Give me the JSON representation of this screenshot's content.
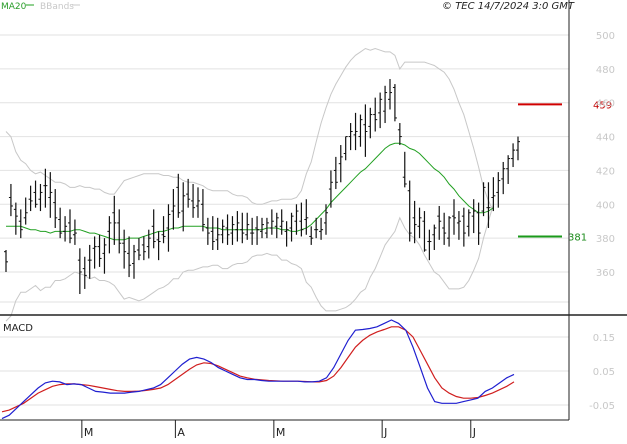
{
  "header": {
    "legend_ma": "MA20",
    "legend_bb": "BBands",
    "copyright": "© TEC 14/7/2024 3:0 GMT"
  },
  "colors": {
    "price_bars": "#111111",
    "ma20": "#22a022",
    "bbands": "#c8c8c8",
    "macd_line": "#1f1fd0",
    "signal_line": "#d01f1f",
    "level_high": "#d00000",
    "level_low": "#1a9a1a",
    "grid": "#e2e2e2",
    "panel_border": "#222222"
  },
  "chart_data": [
    {
      "type": "ohlc",
      "name": "price",
      "y_ticks": [
        360,
        380,
        400,
        420,
        440,
        460,
        480,
        500
      ],
      "y_tick_labels": [
        "360",
        "380",
        "400",
        "420",
        "440",
        "460",
        "480",
        "500"
      ],
      "ylim": [
        340,
        510
      ],
      "x_labels": [
        "M",
        "A",
        "M",
        "J",
        "J"
      ],
      "grid": true,
      "levels": [
        {
          "value": 459,
          "label": "459",
          "kind": "high"
        },
        {
          "value": 381,
          "label": "381",
          "kind": "low"
        }
      ],
      "ohlc": [
        [
          372,
          373,
          360,
          366
        ],
        [
          404,
          412,
          393,
          399
        ],
        [
          397,
          401,
          382,
          393
        ],
        [
          390,
          397,
          380,
          385
        ],
        [
          392,
          404,
          388,
          395
        ],
        [
          403,
          411,
          396,
          402
        ],
        [
          407,
          414,
          398,
          400
        ],
        [
          403,
          412,
          396,
          407
        ],
        [
          411,
          421,
          398,
          411
        ],
        [
          404,
          419,
          392,
          407
        ],
        [
          401,
          409,
          386,
          392
        ],
        [
          391,
          398,
          380,
          383
        ],
        [
          384,
          393,
          378,
          387
        ],
        [
          389,
          397,
          377,
          380
        ],
        [
          382,
          391,
          376,
          383
        ],
        [
          367,
          374,
          347,
          360
        ],
        [
          362,
          369,
          350,
          358
        ],
        [
          367,
          376,
          356,
          367
        ],
        [
          374,
          381,
          362,
          375
        ],
        [
          375,
          382,
          363,
          368
        ],
        [
          371,
          380,
          359,
          376
        ],
        [
          384,
          393,
          371,
          389
        ],
        [
          395,
          405,
          376,
          389
        ],
        [
          389,
          397,
          371,
          377
        ],
        [
          377,
          385,
          362,
          372
        ],
        [
          371,
          381,
          357,
          364
        ],
        [
          365,
          376,
          356,
          372
        ],
        [
          373,
          380,
          367,
          370
        ],
        [
          376,
          381,
          367,
          372
        ],
        [
          375,
          385,
          368,
          380
        ],
        [
          387,
          397,
          374,
          378
        ],
        [
          379,
          384,
          367,
          378
        ],
        [
          382,
          393,
          377,
          381
        ],
        [
          386,
          400,
          372,
          394
        ],
        [
          396,
          409,
          385,
          399
        ],
        [
          410,
          418,
          392,
          395
        ],
        [
          396,
          413,
          384,
          405
        ],
        [
          406,
          415,
          398,
          403
        ],
        [
          402,
          412,
          392,
          398
        ],
        [
          399,
          410,
          392,
          402
        ],
        [
          400,
          409,
          384,
          388
        ],
        [
          386,
          392,
          376,
          383
        ],
        [
          384,
          393,
          373,
          378
        ],
        [
          379,
          392,
          373,
          382
        ],
        [
          382,
          391,
          377,
          387
        ],
        [
          386,
          394,
          376,
          382
        ],
        [
          383,
          393,
          376,
          388
        ],
        [
          385,
          396,
          378,
          389
        ],
        [
          385,
          395,
          377,
          383
        ],
        [
          382,
          395,
          379,
          388
        ],
        [
          383,
          392,
          376,
          383
        ],
        [
          386,
          393,
          376,
          385
        ],
        [
          384,
          392,
          380,
          388
        ],
        [
          383,
          392,
          380,
          389
        ],
        [
          386,
          397,
          382,
          390
        ],
        [
          387,
          395,
          380,
          392
        ],
        [
          387,
          397,
          382,
          390
        ],
        [
          384,
          390,
          375,
          385
        ],
        [
          386,
          395,
          378,
          393
        ],
        [
          390,
          400,
          382,
          396
        ],
        [
          390,
          401,
          381,
          385
        ],
        [
          391,
          403,
          382,
          392
        ],
        [
          381,
          387,
          376,
          380
        ],
        [
          385,
          392,
          380,
          385
        ],
        [
          384,
          392,
          379,
          385
        ],
        [
          389,
          400,
          382,
          395
        ],
        [
          409,
          420,
          398,
          413
        ],
        [
          420,
          428,
          409,
          413
        ],
        [
          424,
          435,
          413,
          428
        ],
        [
          430,
          440,
          426,
          440
        ],
        [
          440,
          448,
          432,
          443
        ],
        [
          441,
          454,
          432,
          443
        ],
        [
          440,
          453,
          434,
          450
        ],
        [
          447,
          459,
          428,
          443
        ],
        [
          446,
          457,
          439,
          453
        ],
        [
          453,
          463,
          443,
          450
        ],
        [
          454,
          466,
          445,
          462
        ],
        [
          455,
          470,
          448,
          466
        ],
        [
          462,
          474,
          456,
          466
        ],
        [
          469,
          471,
          449,
          451
        ],
        [
          444,
          448,
          435,
          440
        ],
        [
          416,
          431,
          410,
          412
        ],
        [
          408,
          414,
          378,
          383
        ],
        [
          392,
          402,
          377,
          388
        ],
        [
          387,
          398,
          380,
          392
        ],
        [
          390,
          396,
          372,
          373
        ],
        [
          378,
          385,
          367,
          378
        ],
        [
          382,
          388,
          373,
          386
        ],
        [
          393,
          399,
          379,
          390
        ],
        [
          386,
          395,
          376,
          383
        ],
        [
          380,
          393,
          375,
          392
        ],
        [
          393,
          403,
          382,
          392
        ],
        [
          389,
          396,
          379,
          390
        ],
        [
          393,
          398,
          375,
          383
        ],
        [
          387,
          397,
          381,
          395
        ],
        [
          393,
          403,
          383,
          396
        ],
        [
          395,
          401,
          376,
          383
        ],
        [
          396,
          413,
          393,
          410
        ],
        [
          398,
          413,
          386,
          398
        ],
        [
          404,
          416,
          396,
          405
        ],
        [
          407,
          419,
          398,
          414
        ],
        [
          415,
          425,
          406,
          421
        ],
        [
          421,
          429,
          412,
          427
        ],
        [
          427,
          436,
          422,
          432
        ],
        [
          432,
          440,
          426,
          437
        ]
      ],
      "ma20": [
        387,
        387,
        387,
        387,
        386,
        385,
        385,
        384,
        384,
        383,
        384,
        384,
        384,
        384,
        385,
        385,
        384,
        383,
        383,
        382,
        381,
        380,
        379,
        379,
        379,
        380,
        380,
        380,
        381,
        382,
        383,
        384,
        384,
        385,
        386,
        386,
        387,
        387,
        387,
        387,
        387,
        386,
        386,
        386,
        385,
        385,
        385,
        385,
        385,
        385,
        385,
        385,
        385,
        386,
        386,
        386,
        385,
        385,
        384,
        384,
        385,
        386,
        388,
        391,
        394,
        397,
        401,
        404,
        407,
        410,
        413,
        416,
        419,
        421,
        424,
        427,
        430,
        433,
        435,
        436,
        436,
        435,
        433,
        432,
        430,
        427,
        424,
        421,
        419,
        416,
        412,
        409,
        405,
        402,
        399,
        397,
        395,
        395,
        396,
        398
      ],
      "bb_upper": [
        443,
        440,
        431,
        426,
        424,
        420,
        418,
        419,
        417,
        415,
        413,
        413,
        412,
        410,
        410,
        411,
        410,
        410,
        409,
        409,
        407,
        406,
        406,
        410,
        414,
        415,
        416,
        417,
        418,
        418,
        418,
        418,
        417,
        417,
        416,
        416,
        414,
        413,
        413,
        412,
        411,
        409,
        408,
        408,
        408,
        408,
        406,
        405,
        405,
        404,
        401,
        400,
        400,
        401,
        402,
        402,
        403,
        403,
        403,
        404,
        408,
        418,
        425,
        437,
        448,
        457,
        465,
        471,
        476,
        481,
        485,
        488,
        490,
        492,
        491,
        492,
        491,
        490,
        490,
        488,
        480,
        484,
        484,
        484,
        484,
        484,
        483,
        482,
        480,
        478,
        474,
        468,
        460,
        453,
        443,
        433,
        422,
        410,
        402,
        396
      ],
      "bb_lower": [
        331,
        334,
        343,
        348,
        348,
        350,
        352,
        349,
        351,
        351,
        355,
        355,
        356,
        358,
        360,
        359,
        358,
        356,
        357,
        355,
        355,
        354,
        352,
        348,
        344,
        345,
        344,
        343,
        344,
        346,
        348,
        350,
        351,
        353,
        356,
        356,
        360,
        361,
        361,
        362,
        363,
        363,
        364,
        364,
        362,
        362,
        364,
        365,
        365,
        366,
        369,
        370,
        370,
        371,
        370,
        370,
        367,
        367,
        365,
        364,
        362,
        354,
        351,
        345,
        340,
        337,
        337,
        337,
        338,
        339,
        341,
        344,
        348,
        350,
        357,
        362,
        369,
        376,
        380,
        384,
        392,
        386,
        382,
        380,
        376,
        370,
        365,
        360,
        358,
        354,
        350,
        350,
        350,
        351,
        355,
        361,
        368,
        380,
        390,
        400
      ]
    },
    {
      "type": "line",
      "name": "MACD",
      "title": "MACD",
      "y_ticks": [
        -0.05,
        0.05,
        0.15
      ],
      "y_tick_labels": [
        "-0.05",
        "0.05",
        "0.15"
      ],
      "ylim": [
        -0.1,
        0.21
      ],
      "series": [
        {
          "name": "MACD",
          "values": [
            -0.09,
            -0.08,
            -0.06,
            -0.04,
            -0.02,
            0.0,
            0.015,
            0.02,
            0.018,
            0.01,
            0.012,
            0.01,
            0.0,
            -0.01,
            -0.012,
            -0.015,
            -0.015,
            -0.015,
            -0.012,
            -0.01,
            -0.005,
            0.0,
            0.01,
            0.03,
            0.05,
            0.07,
            0.085,
            0.09,
            0.085,
            0.075,
            0.06,
            0.05,
            0.04,
            0.03,
            0.025,
            0.025,
            0.022,
            0.02,
            0.02,
            0.02,
            0.02,
            0.02,
            0.018,
            0.018,
            0.02,
            0.03,
            0.06,
            0.1,
            0.14,
            0.17,
            0.172,
            0.175,
            0.18,
            0.19,
            0.2,
            0.19,
            0.17,
            0.12,
            0.06,
            0.0,
            -0.04,
            -0.045,
            -0.045,
            -0.045,
            -0.04,
            -0.035,
            -0.03,
            -0.01,
            0.0,
            0.015,
            0.03,
            0.04
          ]
        },
        {
          "name": "Signal",
          "values": [
            -0.07,
            -0.065,
            -0.055,
            -0.045,
            -0.03,
            -0.015,
            -0.005,
            0.005,
            0.01,
            0.012,
            0.012,
            0.01,
            0.008,
            0.004,
            0.0,
            -0.004,
            -0.008,
            -0.01,
            -0.01,
            -0.009,
            -0.007,
            -0.004,
            0.0,
            0.01,
            0.025,
            0.04,
            0.055,
            0.068,
            0.074,
            0.072,
            0.065,
            0.055,
            0.045,
            0.035,
            0.03,
            0.026,
            0.024,
            0.022,
            0.021,
            0.02,
            0.02,
            0.02,
            0.019,
            0.018,
            0.018,
            0.022,
            0.035,
            0.06,
            0.09,
            0.12,
            0.14,
            0.155,
            0.165,
            0.172,
            0.18,
            0.18,
            0.17,
            0.15,
            0.11,
            0.07,
            0.03,
            0.0,
            -0.015,
            -0.025,
            -0.03,
            -0.03,
            -0.028,
            -0.022,
            -0.015,
            -0.005,
            0.005,
            0.018
          ]
        }
      ]
    }
  ]
}
